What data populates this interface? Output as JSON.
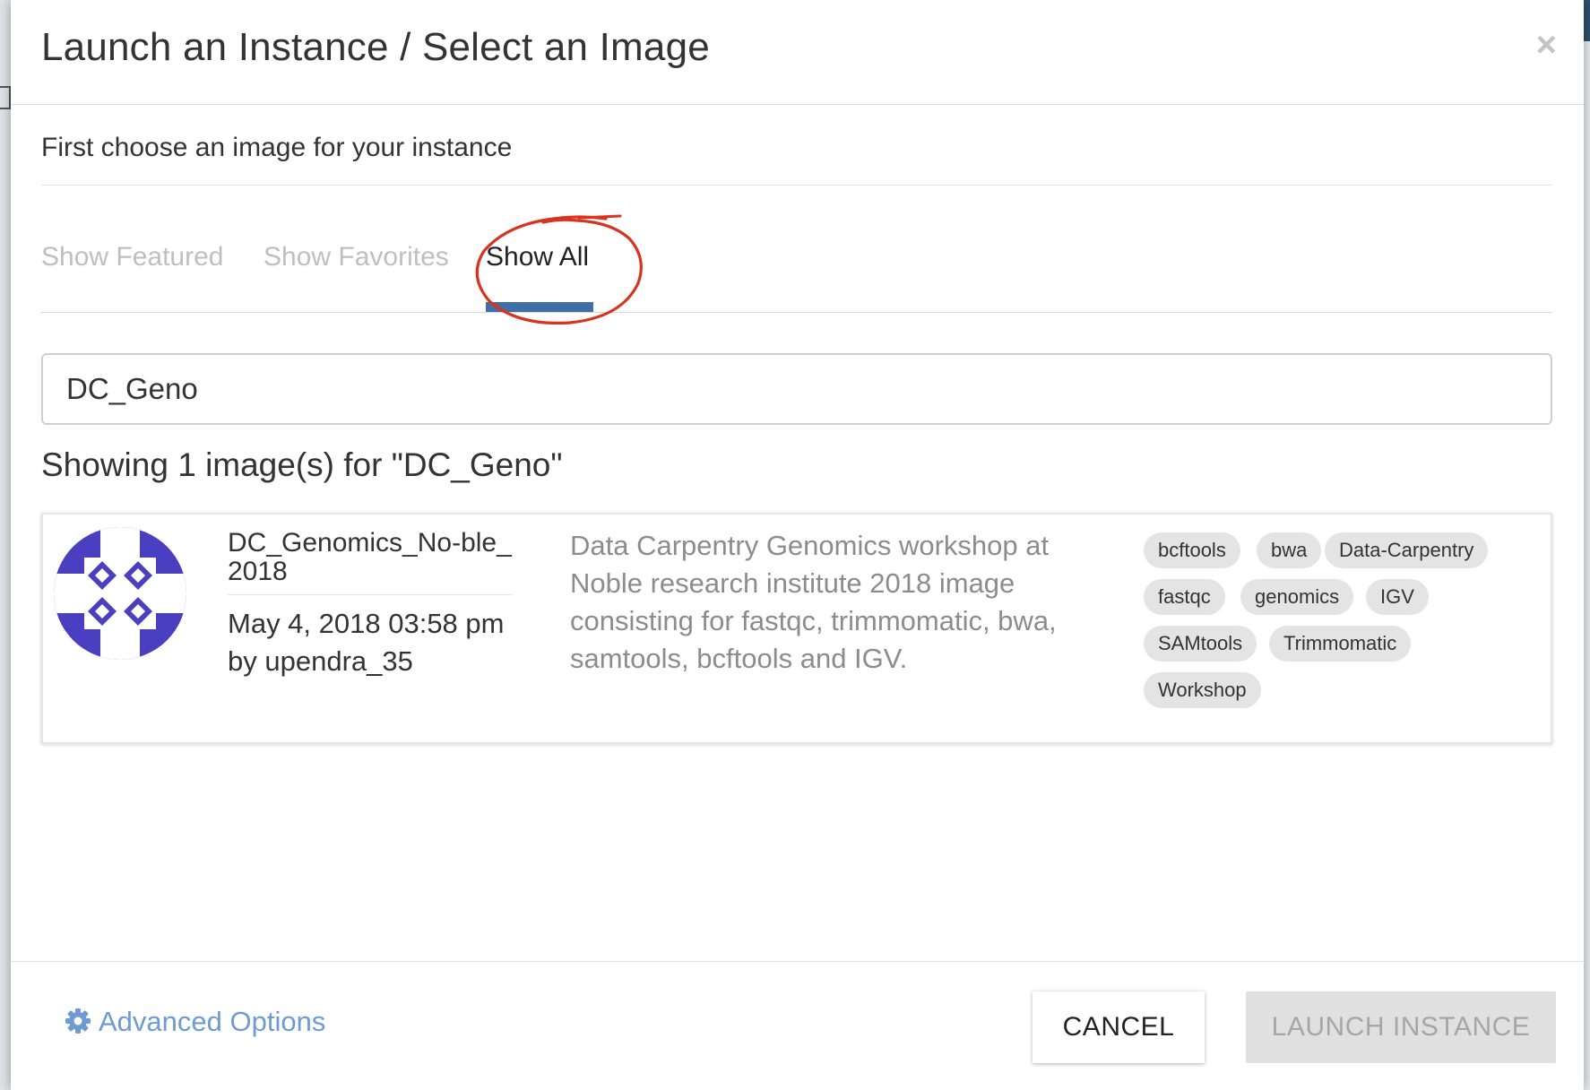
{
  "dialog": {
    "title": "Launch an Instance / Select an Image",
    "close_symbol": "×",
    "subtitle": "First choose an image for your instance"
  },
  "tabs": [
    {
      "label": "Show Featured",
      "active": false
    },
    {
      "label": "Show Favorites",
      "active": false
    },
    {
      "label": "Show All",
      "active": true
    }
  ],
  "search": {
    "value": "DC_Geno"
  },
  "results": {
    "heading": "Showing 1 image(s) for \"DC_Geno\""
  },
  "image": {
    "name": "DC_Genomics_No-ble_2018",
    "date": "May 4, 2018 03:58 pm",
    "author_prefix": "by",
    "author": "upendra_35",
    "description": "Data Carpentry Genomics workshop at Noble research institute 2018 image consisting for fastqc, trimmomatic, bwa, samtools, bcftools and IGV.",
    "avatar_color": "#4a3fc0",
    "tags": [
      "bcftools",
      "bwa",
      "Data-Carpentry",
      "fastqc",
      "genomics",
      "IGV",
      "SAMtools",
      "Trimmomatic",
      "Workshop"
    ]
  },
  "footer": {
    "advanced_options": "Advanced Options",
    "cancel": "CANCEL",
    "launch": "LAUNCH INSTANCE"
  },
  "colors": {
    "accent": "#3f6fa4",
    "link": "#6e9bd1",
    "annotation": "#d9321f",
    "disabled": "#e0e0e0"
  },
  "icons": {
    "close": "close-icon",
    "settings": "gear-icon"
  }
}
